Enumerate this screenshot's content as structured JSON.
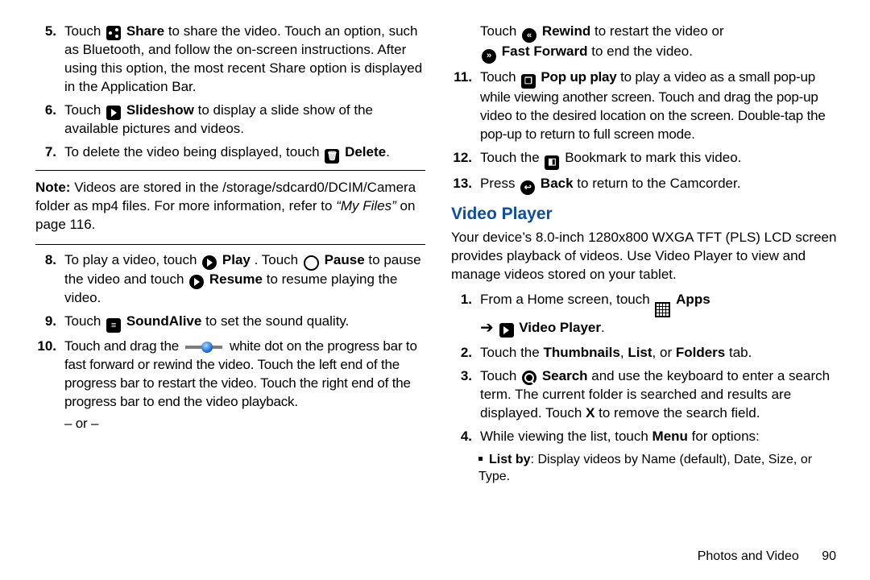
{
  "left": {
    "s5": {
      "n": "5.",
      "a": "Touch ",
      "share": "Share",
      "b": " to share the video. Touch an option, such as Bluetooth, and follow the on-screen instructions. After using this option, the most recent Share option is displayed in the Application Bar."
    },
    "s6": {
      "n": "6.",
      "a": "Touch ",
      "slide": "Slideshow",
      "b": " to display a slide show of the available pictures and videos."
    },
    "s7": {
      "n": "7.",
      "a": "To delete the video being displayed, touch ",
      "del": "Delete",
      "dot": "."
    },
    "note": {
      "label": "Note:",
      "a": " Videos are stored in the /storage/sdcard0/DCIM/Camera folder as mp4 files. For more information, refer to ",
      "ref": "“My Files”",
      "b": " on page 116."
    },
    "s8": {
      "n": "8.",
      "a": "To play a video, touch ",
      "play": "Play",
      "b": ". Touch ",
      "pause": "Pause",
      "c": " to pause the video and touch ",
      "resume": "Resume",
      "d": " to resume playing the video."
    },
    "s9": {
      "n": "9.",
      "a": "Touch ",
      "sa": "SoundAlive",
      "b": " to set the sound quality."
    },
    "s10": {
      "n": "10.",
      "a": "Touch and drag the ",
      "b": " white dot on the progress bar to fast forward or rewind the video. Touch the left end of the progress bar to restart the video. Touch the right end of the progress bar to end the video playback.",
      "or": "– or –"
    }
  },
  "right": {
    "top1": {
      "a": "Touch ",
      "rw": "Rewind",
      "b": " to restart the video or"
    },
    "top2": {
      "ff": "Fast Forward",
      "a": " to end the video."
    },
    "s11": {
      "n": "11.",
      "a": "Touch ",
      "pop": "Pop up play",
      "b": " to play a video as a small pop-up while viewing another screen. Touch and drag the pop-up video to the desired location on the screen. Double-tap the pop-up to return to full screen mode."
    },
    "s12": {
      "n": "12.",
      "a": "Touch the ",
      "b": " Bookmark to mark this video."
    },
    "s13": {
      "n": "13.",
      "a": "Press ",
      "back": "Back",
      "b": " to return to the Camcorder."
    },
    "heading": "Video Player",
    "intro": "Your device’s 8.0-inch 1280x800 WXGA TFT (PLS) LCD screen provides playback of videos. Use Video Player to view and manage videos stored on your tablet.",
    "v1": {
      "n": "1.",
      "a": "From a Home screen, touch ",
      "apps": "Apps",
      "arrow": "➔",
      "vp": "Video Player",
      "dot": "."
    },
    "v2": {
      "n": "2.",
      "a": "Touch the ",
      "th": "Thumbnails",
      "c1": ", ",
      "li": "List",
      "c2": ", or ",
      "fo": "Folders",
      "b": " tab."
    },
    "v3": {
      "n": "3.",
      "a": "Touch ",
      "search": "Search",
      "b": " and use the keyboard to enter a search term. The current folder is searched and results are displayed. Touch ",
      "x": "X",
      "c": " to remove the search field."
    },
    "v4": {
      "n": "4.",
      "a": "While viewing the list, touch ",
      "menu": "Menu",
      "b": " for options:"
    },
    "v4b": {
      "lb": "List by",
      "a": ": Display videos by Name (default), Date, Size, or Type."
    }
  },
  "footer": {
    "section": "Photos and Video",
    "page": "90"
  }
}
